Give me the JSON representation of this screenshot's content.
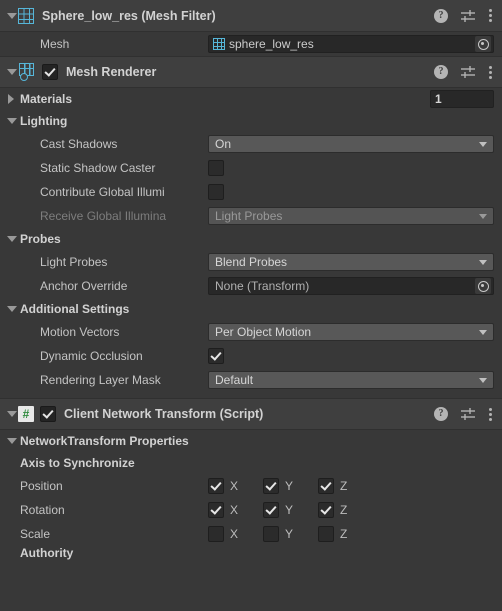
{
  "theme": {
    "background": "#383838",
    "header_background": "#3f3f3f",
    "text": "#c4c4c4",
    "text_disabled": "#7d7d7d",
    "accent_icon": "#56b6d8",
    "script_icon_green": "#2f8a3e",
    "field_dark": "#282828",
    "dropdown_bg": "#585858"
  },
  "components": [
    {
      "id": "mesh-filter",
      "title": "Sphere_low_res (Mesh Filter)",
      "icon": "mesh-filter-icon",
      "expanded": true,
      "has_enable_toggle": false,
      "header_icons": [
        "help-icon",
        "preset-icon",
        "kebab-menu-icon"
      ],
      "rows": [
        {
          "type": "object",
          "label": "Mesh",
          "value": "sphere_low_res",
          "value_icon": "mesh-asset-icon",
          "is_none": false
        }
      ]
    },
    {
      "id": "mesh-renderer",
      "title": "Mesh Renderer",
      "icon": "mesh-renderer-icon",
      "expanded": true,
      "has_enable_toggle": true,
      "enabled": true,
      "header_icons": [
        "help-icon",
        "preset-icon",
        "kebab-menu-icon"
      ],
      "sections": [
        {
          "name": "Materials",
          "expanded": false,
          "rows": [],
          "inline_value": "1"
        },
        {
          "name": "Lighting",
          "expanded": true,
          "rows": [
            {
              "type": "dropdown",
              "label": "Cast Shadows",
              "value": "On",
              "disabled": false
            },
            {
              "type": "checkbox",
              "label": "Static Shadow Caster",
              "checked": false,
              "disabled": false
            },
            {
              "type": "checkbox",
              "label": "Contribute Global Illumi",
              "checked": false,
              "disabled": false
            },
            {
              "type": "dropdown",
              "label": "Receive Global Illumina",
              "value": "Light Probes",
              "disabled": true
            }
          ]
        },
        {
          "name": "Probes",
          "expanded": true,
          "rows": [
            {
              "type": "dropdown",
              "label": "Light Probes",
              "value": "Blend Probes",
              "disabled": false
            },
            {
              "type": "object",
              "label": "Anchor Override",
              "value": "None (Transform)",
              "is_none": true
            }
          ]
        },
        {
          "name": "Additional Settings",
          "expanded": true,
          "rows": [
            {
              "type": "dropdown",
              "label": "Motion Vectors",
              "value": "Per Object Motion",
              "disabled": false
            },
            {
              "type": "checkbox",
              "label": "Dynamic Occlusion",
              "checked": true,
              "disabled": false
            },
            {
              "type": "dropdown",
              "label": "Rendering Layer Mask",
              "value": "Default",
              "disabled": false
            }
          ]
        }
      ]
    },
    {
      "id": "client-network-transform",
      "title": "Client Network Transform (Script)",
      "icon": "csharp-script-icon",
      "expanded": true,
      "has_enable_toggle": true,
      "enabled": true,
      "header_icons": [
        "help-icon",
        "preset-icon",
        "kebab-menu-icon"
      ],
      "properties_group": "NetworkTransform Properties",
      "subheading": "Axis to Synchronize",
      "axis_labels": [
        "X",
        "Y",
        "Z"
      ],
      "axis_rows": [
        {
          "label": "Position",
          "x": true,
          "y": true,
          "z": true
        },
        {
          "label": "Rotation",
          "x": true,
          "y": true,
          "z": true
        },
        {
          "label": "Scale",
          "x": false,
          "y": false,
          "z": false
        }
      ],
      "next_section_clipped": "Authority"
    }
  ]
}
